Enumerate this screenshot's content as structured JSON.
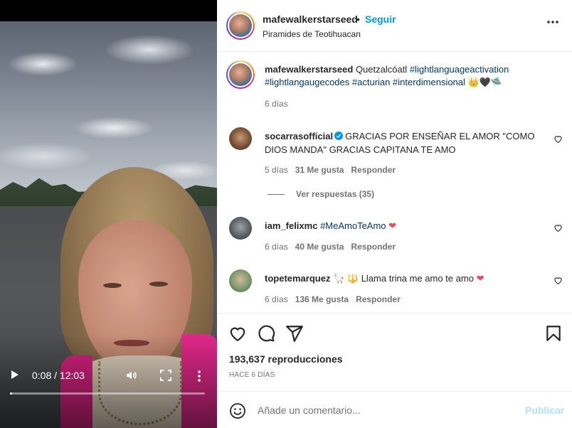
{
  "video": {
    "time": "0:08 / 12:03",
    "progress_fraction": 0.011
  },
  "header": {
    "username": "mafewalkerstarseed",
    "separator": "•",
    "follow_label": "Seguir",
    "location": "Piramides de Teotihuacan"
  },
  "caption": {
    "username": "mafewalkerstarseed",
    "text": "Quetzalcóatl",
    "hashtags": [
      "#lightlanguageactivation",
      "#lightlangaugecodes",
      "#acturian",
      "#interdimensional"
    ],
    "emoji": "👑🖤🛸",
    "time": "6 días"
  },
  "comments": [
    {
      "username": "socarrasofficial",
      "verified": true,
      "text": "GRACIAS POR ENSEÑAR EL AMOR \"COMO DIOS MANDA\" GRACIAS CAPITANA TE AMO",
      "time": "5 días",
      "likes": "31 Me gusta",
      "reply": "Responder",
      "view_replies": "Ver respuestas (35)"
    },
    {
      "username": "iam_felixmc",
      "tag": "#MeAmoTeAmo",
      "text": "",
      "emoji": "❤",
      "time": "6 días",
      "likes": "40 Me gusta",
      "reply": "Responder"
    },
    {
      "username": "topetemarquez",
      "text": "🦙 🔱 Llama trina me amo te amo",
      "emoji": "❤",
      "time": "6 días",
      "likes": "136 Me gusta",
      "reply": "Responder"
    }
  ],
  "stats": {
    "views": "193,637 reproducciones",
    "ago": "HACE 6 DÍAS"
  },
  "composer": {
    "placeholder": "Añade un comentario...",
    "publish_label": "Publicar"
  },
  "colors": {
    "link_blue": "#0095f6",
    "hashtag": "#00376b",
    "muted": "#737373",
    "like_red": "#ed4956",
    "publish_disabled": "#b2dffc"
  },
  "icons": [
    "play-icon",
    "volume-icon",
    "fullscreen-icon",
    "more-vertical-icon",
    "more-horizontal-icon",
    "heart-icon",
    "comment-icon",
    "share-icon",
    "bookmark-icon",
    "emoji-icon",
    "verified-icon"
  ]
}
